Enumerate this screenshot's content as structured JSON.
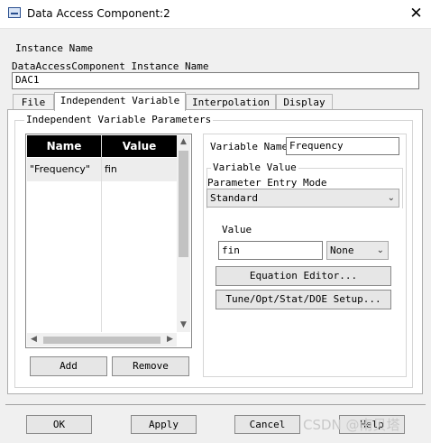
{
  "window": {
    "title": "Data Access Component:2",
    "close_glyph": "✕",
    "app_icon": "ads-component-icon"
  },
  "instance": {
    "label": "Instance Name",
    "sublabel": "DataAccessComponent Instance Name",
    "value": "DAC1"
  },
  "tabs": [
    {
      "label": "File",
      "active": false
    },
    {
      "label": "Independent Variable",
      "active": true
    },
    {
      "label": "Interpolation",
      "active": false
    },
    {
      "label": "Display",
      "active": false
    }
  ],
  "params_group": {
    "title": "Independent Variable Parameters"
  },
  "table": {
    "columns": [
      "Name",
      "Value"
    ],
    "rows": [
      {
        "name": "\"Frequency\"",
        "value": "fin"
      }
    ]
  },
  "table_buttons": {
    "add": "Add",
    "remove": "Remove"
  },
  "variable_name": {
    "label": "Variable Name",
    "value": "Frequency"
  },
  "variable_value": {
    "title": "Variable Value",
    "entry_mode_label": "Parameter Entry Mode",
    "entry_mode_value": "Standard",
    "value_label": "Value",
    "value": "fin",
    "unit_value": "None",
    "equation_editor": "Equation Editor...",
    "tune_setup": "Tune/Opt/Stat/DOE Setup..."
  },
  "footer": {
    "ok": "OK",
    "apply": "Apply",
    "cancel": "Cancel",
    "help": "Help"
  },
  "watermark": "CSDN @南贝塔"
}
